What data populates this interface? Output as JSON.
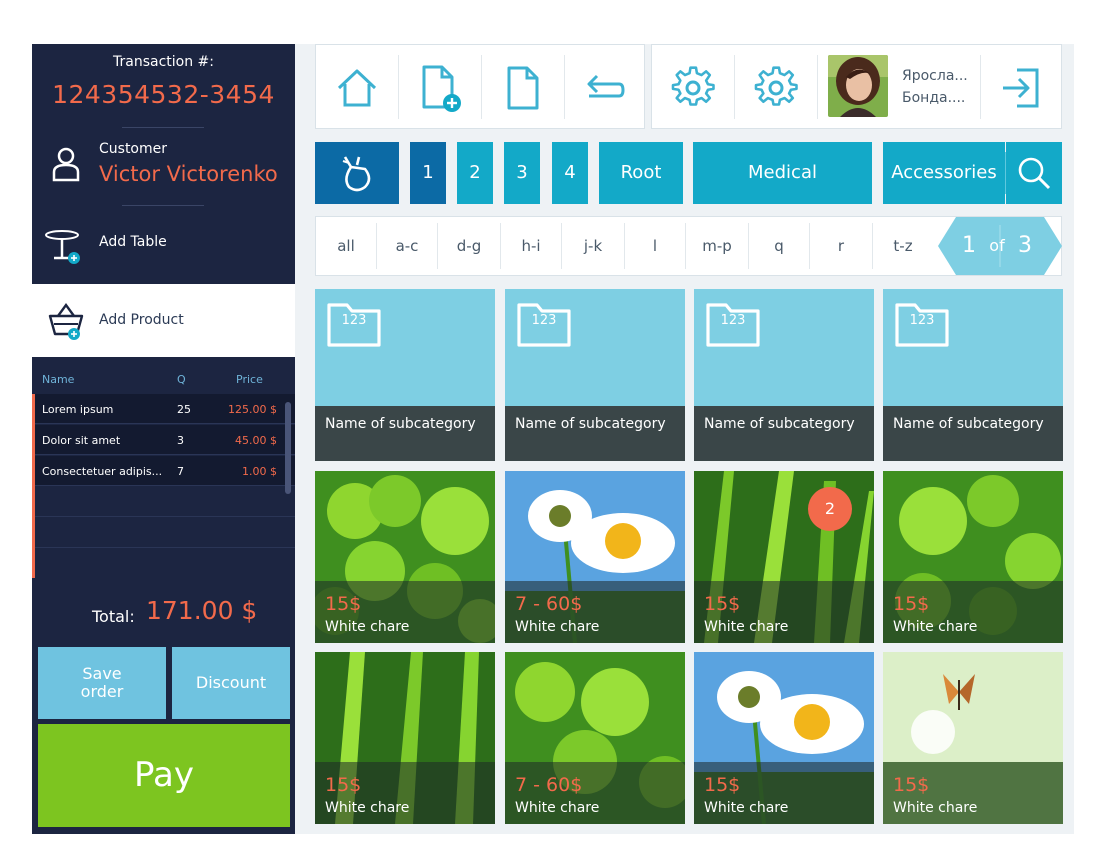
{
  "transaction": {
    "label": "Transaction #:",
    "number": "124354532-3454"
  },
  "customer": {
    "label": "Customer",
    "name": "Victor Victorenko"
  },
  "add_table": {
    "label": "Add Table"
  },
  "add_product": {
    "label": "Add Product"
  },
  "order": {
    "headers": {
      "name": "Name",
      "q": "Q",
      "price": "Price"
    },
    "rows": [
      {
        "name": "Lorem ipsum",
        "q": "25",
        "price": "125.00 $"
      },
      {
        "name": "Dolor sit amet",
        "q": "3",
        "price": "45.00 $"
      },
      {
        "name": "Consectetuer adipis...",
        "q": "7",
        "price": "1.00 $"
      }
    ]
  },
  "total": {
    "label": "Total:",
    "value": "171.00 $"
  },
  "actions": {
    "save": "Save order",
    "save_line1": "Save",
    "save_line2": "order",
    "discount": "Discount",
    "pay": "Pay"
  },
  "toolbar": {
    "icons": [
      "home-icon",
      "new-document-icon",
      "document-icon",
      "undo-icon",
      "settings-icon",
      "settings-icon",
      "logout-icon"
    ],
    "user": {
      "first": "Яросла...",
      "last": "Бонда...."
    }
  },
  "categories": {
    "numbers": [
      "1",
      "2",
      "3",
      "4"
    ],
    "root": "Root",
    "medical": "Medical",
    "accessories": "Accessories"
  },
  "alpha_filter": [
    "all",
    "a-c",
    "d-g",
    "h-i",
    "j-k",
    "l",
    "m-p",
    "q",
    "r",
    "t-z"
  ],
  "pagination": {
    "current": "1",
    "of": "of",
    "total": "3"
  },
  "subcategories": [
    {
      "folder": "123",
      "name": "Name of subcategory"
    },
    {
      "folder": "123",
      "name": "Name of subcategory"
    },
    {
      "folder": "123",
      "name": "Name of subcategory"
    },
    {
      "folder": "123",
      "name": "Name of subcategory"
    }
  ],
  "products": [
    {
      "price": "15$",
      "name": "White chare",
      "image": "clover"
    },
    {
      "price": "7 - 60$",
      "name": "White chare",
      "image": "daisy"
    },
    {
      "price": "15$",
      "name": "White chare",
      "image": "grass",
      "badge": "2"
    },
    {
      "price": "15$",
      "name": "White chare",
      "image": "clover"
    },
    {
      "price": "15$",
      "name": "White chare",
      "image": "grass"
    },
    {
      "price": "7 - 60$",
      "name": "White chare",
      "image": "clover"
    },
    {
      "price": "15$",
      "name": "White chare",
      "image": "daisy"
    },
    {
      "price": "15$",
      "name": "White chare",
      "image": "butterfly"
    }
  ],
  "colors": {
    "panel": "#1c2541",
    "accent": "#f26a4b",
    "primary": "#13a9c8",
    "pay": "#7dc520",
    "tile": "#7ecfe3"
  }
}
